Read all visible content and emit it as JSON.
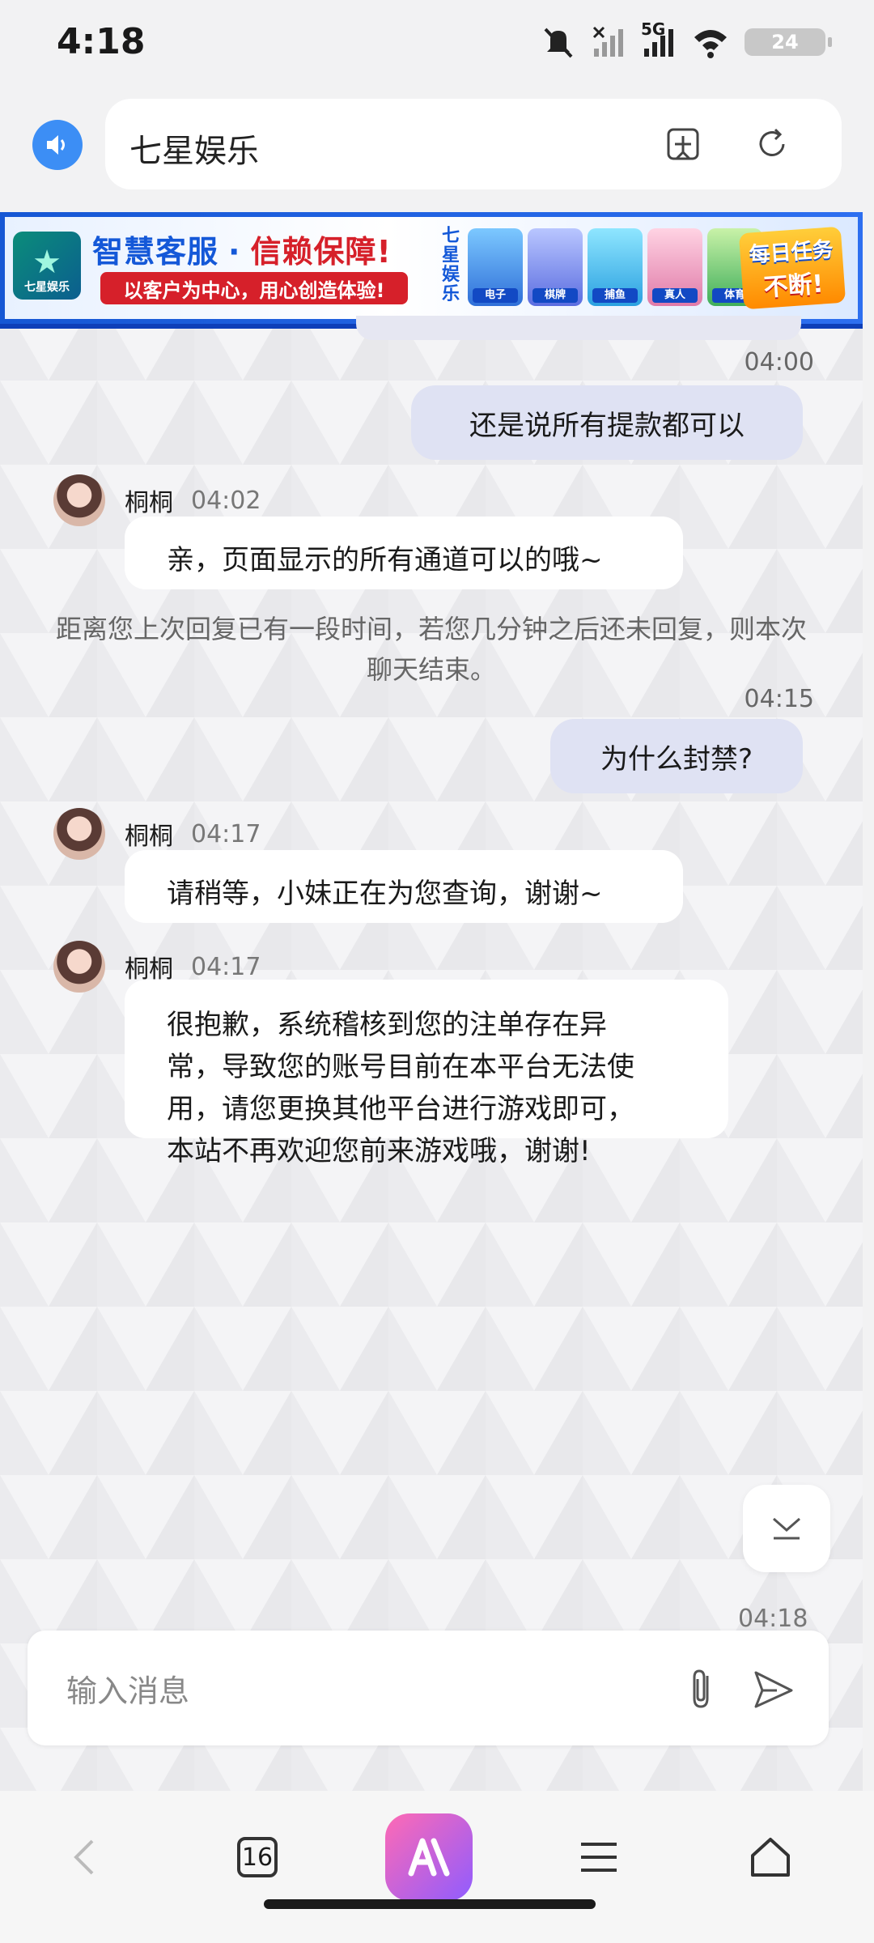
{
  "status_bar": {
    "time": "4:18",
    "network": "5G",
    "battery": "24"
  },
  "browser": {
    "url_text": "七星娱乐",
    "tabs_count": "16",
    "icons": {
      "speaker": "speaker-icon",
      "add_bookmark": "add-bookmark-icon",
      "refresh": "refresh-icon"
    }
  },
  "banner": {
    "logo_text": "七星娱乐",
    "headline_blue": "智慧客服",
    "separator": "·",
    "headline_red": "信赖保障!",
    "subline": "以客户为中心，用心创造体验!",
    "brand_vertical": "七星娱乐",
    "games": [
      "电子",
      "棋牌",
      "捕鱼",
      "真人",
      "体育"
    ],
    "daily_task_line1": "每日任务",
    "daily_task_line2": "不断!"
  },
  "chat": {
    "messages": [
      {
        "sender": "user",
        "time": "04:00",
        "text": "还是说所有提款都可以"
      },
      {
        "sender": "agent",
        "name": "桐桐",
        "time": "04:02",
        "text": "亲，页面显示的所有通道可以的哦~"
      },
      {
        "sender": "system",
        "text": "距离您上次回复已有一段时间，若您几分钟之后还未回复，则本次聊天结束。"
      },
      {
        "sender": "user",
        "time": "04:15",
        "text": "为什么封禁?"
      },
      {
        "sender": "agent",
        "name": "桐桐",
        "time": "04:17",
        "text": "请稍等，小妹正在为您查询，谢谢~"
      },
      {
        "sender": "agent",
        "name": "桐桐",
        "time": "04:17",
        "lines": [
          "很抱歉，系统稽核到您的注单存在异",
          "常，导致您的账号目前在本平台无法使",
          "用，请您更换其他平台进行游戏即可，",
          "本站不再欢迎您前来游戏哦，谢谢!"
        ]
      }
    ],
    "partial_time": "04:18",
    "composer_placeholder": "输入消息"
  },
  "colors": {
    "user_bubble": "#dfe2f3",
    "agent_bubble": "#ffffff",
    "banner_blue": "#1458d8",
    "banner_red": "#d6202a",
    "speaker_blue": "#3c8ef5"
  }
}
